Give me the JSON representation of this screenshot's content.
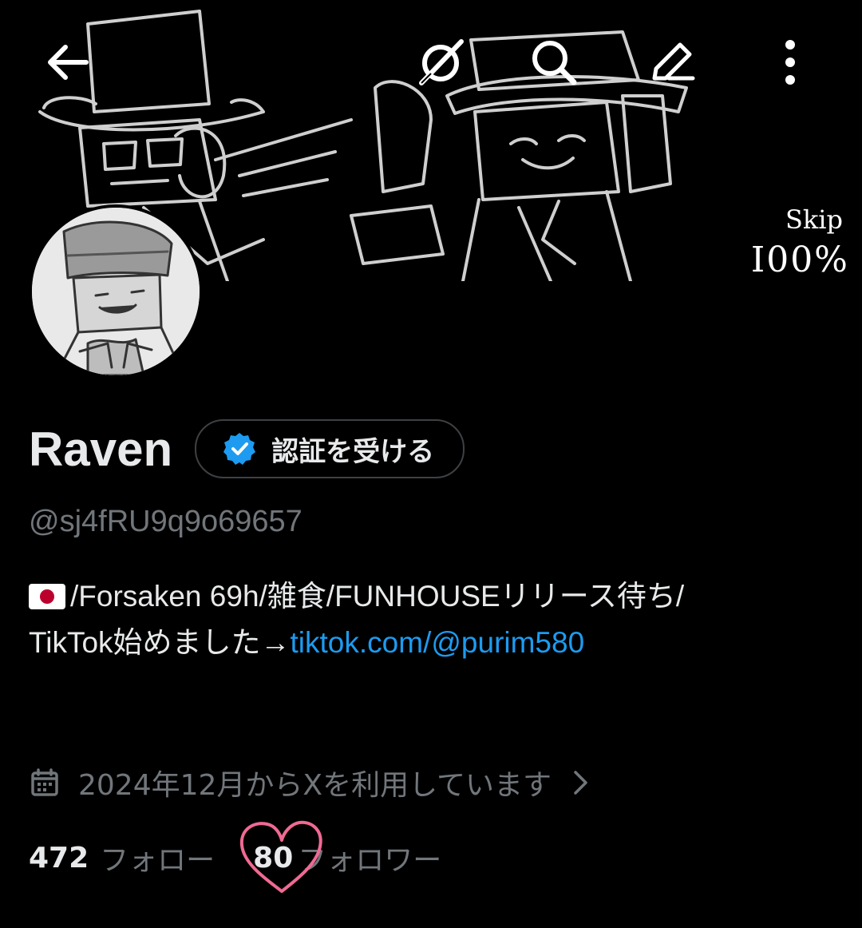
{
  "header": {
    "back_icon": "arrow-left-icon",
    "actions": [
      {
        "icon": "grok-icon"
      },
      {
        "icon": "search-icon"
      },
      {
        "icon": "edit-icon"
      },
      {
        "icon": "more-vertical-icon"
      }
    ]
  },
  "banner": {
    "skip_label": "Skip",
    "skip_percent": "I00%"
  },
  "profile": {
    "display_name": "Raven",
    "verify_label": "認証を受ける",
    "handle": "@sj4fRU9q9o69657",
    "bio_line1": "/Forsaken 69h/雑食/FUNHOUSEリリース待ち/",
    "bio_line2_prefix": "TikTok始めました→",
    "bio_link": "tiktok.com/@purim580",
    "joined": "2024年12月からXを利用しています"
  },
  "stats": {
    "following_count": "472",
    "following_label": "フォロー",
    "followers_count": "80",
    "followers_label": "フォロワー"
  },
  "colors": {
    "background": "#000000",
    "text_primary": "#e7e9ea",
    "text_secondary": "#71767b",
    "link": "#1d9bf0",
    "verified_badge": "#1d9bf0",
    "heart_doodle": "#f06a93"
  }
}
